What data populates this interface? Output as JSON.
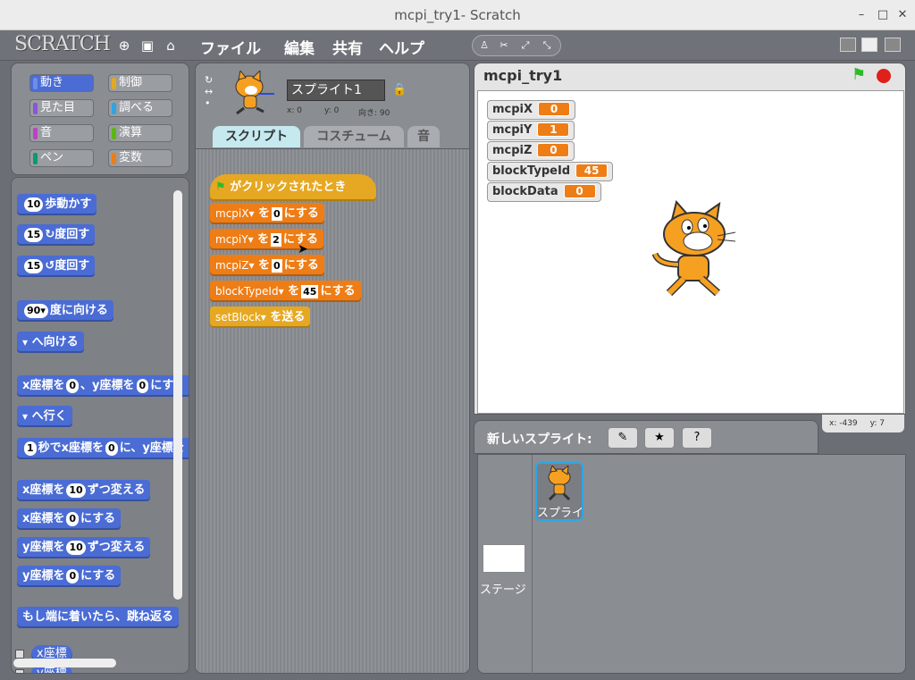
{
  "window": {
    "title": "mcpi_try1- Scratch"
  },
  "menu": {
    "logo": "SCRATCH",
    "file": "ファイル",
    "edit": "編集",
    "share": "共有",
    "help": "ヘルプ"
  },
  "categories": [
    {
      "label": "動き",
      "color": "#4a6cd4"
    },
    {
      "label": "制御",
      "color": "#e6a822"
    },
    {
      "label": "見た目",
      "color": "#8a55d7"
    },
    {
      "label": "調べる",
      "color": "#2ca5e2"
    },
    {
      "label": "音",
      "color": "#bb42c3"
    },
    {
      "label": "演算",
      "color": "#5cb712"
    },
    {
      "label": "ペン",
      "color": "#0e9a6c"
    },
    {
      "label": "変数",
      "color": "#ee7d16"
    }
  ],
  "palette": {
    "move": {
      "n": "10",
      "t": "歩動かす"
    },
    "turn_right": {
      "n": "15",
      "t": "度回す"
    },
    "turn_left": {
      "n": "15",
      "t": "度回す"
    },
    "point_dir": {
      "n": "90",
      "t": "度に向ける"
    },
    "point_towards": {
      "t": "へ向ける"
    },
    "goto_xy": {
      "a": "x座標を",
      "n1": "0",
      "b": "、y座標を",
      "n2": "0",
      "c": "にす"
    },
    "goto": {
      "t": "へ行く"
    },
    "glide": {
      "n": "1",
      "a": "秒でx座標を",
      "n2": "0",
      "b": "に、y座標を"
    },
    "change_x": {
      "a": "x座標を",
      "n": "10",
      "b": "ずつ変える"
    },
    "set_x": {
      "a": "x座標を",
      "n": "0",
      "b": "にする"
    },
    "change_y": {
      "a": "y座標を",
      "n": "10",
      "b": "ずつ変える"
    },
    "set_y": {
      "a": "y座標を",
      "n": "0",
      "b": "にする"
    },
    "bounce": "もし端に着いたら、跳ね返る",
    "xpos": "x座標",
    "ypos": "y座標"
  },
  "sprite_header": {
    "name": "スプライト1",
    "x_label": "x: 0",
    "y_label": "y: 0",
    "dir_label": "向き: 90"
  },
  "tabs": {
    "scripts": "スクリプト",
    "costumes": "コスチューム",
    "sounds": "音"
  },
  "script": {
    "hat": "がクリックされたとき",
    "rows": [
      {
        "var": "mcpiX",
        "wo": "を",
        "val": "0",
        "suru": "にする"
      },
      {
        "var": "mcpiY",
        "wo": "を",
        "val": "2",
        "suru": "にする"
      },
      {
        "var": "mcpiZ",
        "wo": "を",
        "val": "0",
        "suru": "にする"
      },
      {
        "var": "blockTypeId",
        "wo": "を",
        "val": "45",
        "suru": "にする"
      }
    ],
    "broadcast": {
      "msg": "setBlock",
      "t": "を送る"
    }
  },
  "stage": {
    "title": "mcpi_try1",
    "monitors": [
      {
        "name": "mcpiX",
        "value": "0"
      },
      {
        "name": "mcpiY",
        "value": "1"
      },
      {
        "name": "mcpiZ",
        "value": "0"
      },
      {
        "name": "blockTypeId",
        "value": "45"
      },
      {
        "name": "blockData",
        "value": "0"
      }
    ],
    "mouse_x": "x: -439",
    "mouse_y": "y: 7"
  },
  "new_sprite": {
    "label": "新しいスプライト:"
  },
  "sprites": [
    {
      "name": "スプライト1"
    }
  ],
  "stage_thumb": {
    "label": "ステージ"
  }
}
